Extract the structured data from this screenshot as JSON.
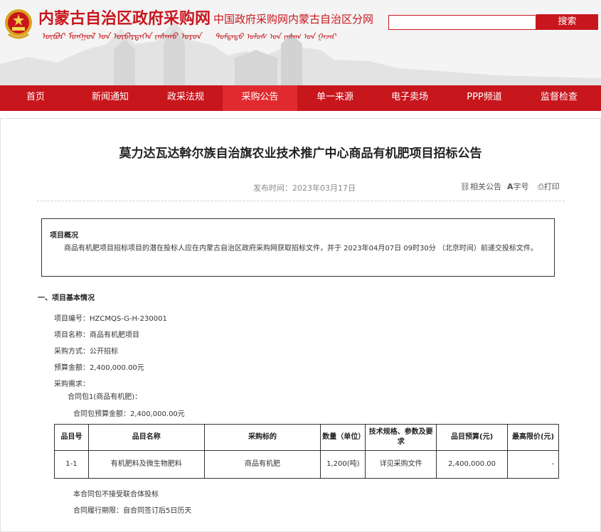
{
  "header": {
    "site_title": "内蒙古自治区政府采购网",
    "site_title_mongol": "ᠥᠪᠦᠷ ᠮᠣᠩᠭᠣᠯ ᠤᠨ ᠥᠪᠡᠷᠲᠡᠭᠡᠨ ᠵᠠᠰᠠᠬᠤ ᠣᠷᠣᠨ",
    "sub_title": "中国政府采购网内蒙古自治区分网",
    "sub_title_mongol": "ᠳᠤᠮᠳᠠᠳᠤ ᠤᠯᠤᠰ ᠤᠨ ᠵᠠᠰᠠᠭ ᠤᠨ ᠭᠠᠵᠠᠷ",
    "search_placeholder": "",
    "search_label": "搜索"
  },
  "nav": {
    "items": [
      "首页",
      "新闻通知",
      "政采法规",
      "采购公告",
      "单一来源",
      "电子卖场",
      "PPP频道",
      "监督检查"
    ],
    "active_index": 3
  },
  "article": {
    "title": "莫力达瓦达斡尔族自治旗农业技术推广中心商品有机肥项目招标公告",
    "publish_time": "发布时间：2023年03月17日",
    "tools": {
      "related": "相关公告",
      "font": "字号",
      "print": "打印"
    },
    "summary": {
      "heading": "项目概况",
      "text": "商品有机肥项目招标项目的潜在投标人应在内蒙古自治区政府采购网获取招标文件，并于 2023年04月07日 09时30分 （北京时间）前递交投标文件。"
    },
    "section1": {
      "heading": "一、项目基本情况",
      "project_no": "项目编号：HZCMQS-G-H-230001",
      "project_name": "项目名称：商品有机肥项目",
      "method": "采购方式：公开招标",
      "budget": "预算金额：2,400,000.00元",
      "demand": "采购需求：",
      "package": "合同包1(商品有机肥)：",
      "package_budget": "合同包预算金额：2,400,000.00元",
      "table": {
        "headers": [
          "品目号",
          "品目名称",
          "采购标的",
          "数量（单位）",
          "技术规格、参数及要求",
          "品目预算(元)",
          "最高限价(元)"
        ],
        "rows": [
          [
            "1-1",
            "有机肥料及微生物肥料",
            "商品有机肥",
            "1,200(吨)",
            "详见采购文件",
            "2,400,000.00",
            "-"
          ]
        ]
      },
      "no_consortium": "本合同包不接受联合体投标",
      "period": "合同履行期限：自合同签订后5日历天"
    }
  },
  "colors": {
    "brand_red": "#c8161d",
    "nav_active": "#e02a30"
  },
  "icons": [
    "national-emblem-icon",
    "link-icon",
    "font-size-icon",
    "print-icon"
  ]
}
